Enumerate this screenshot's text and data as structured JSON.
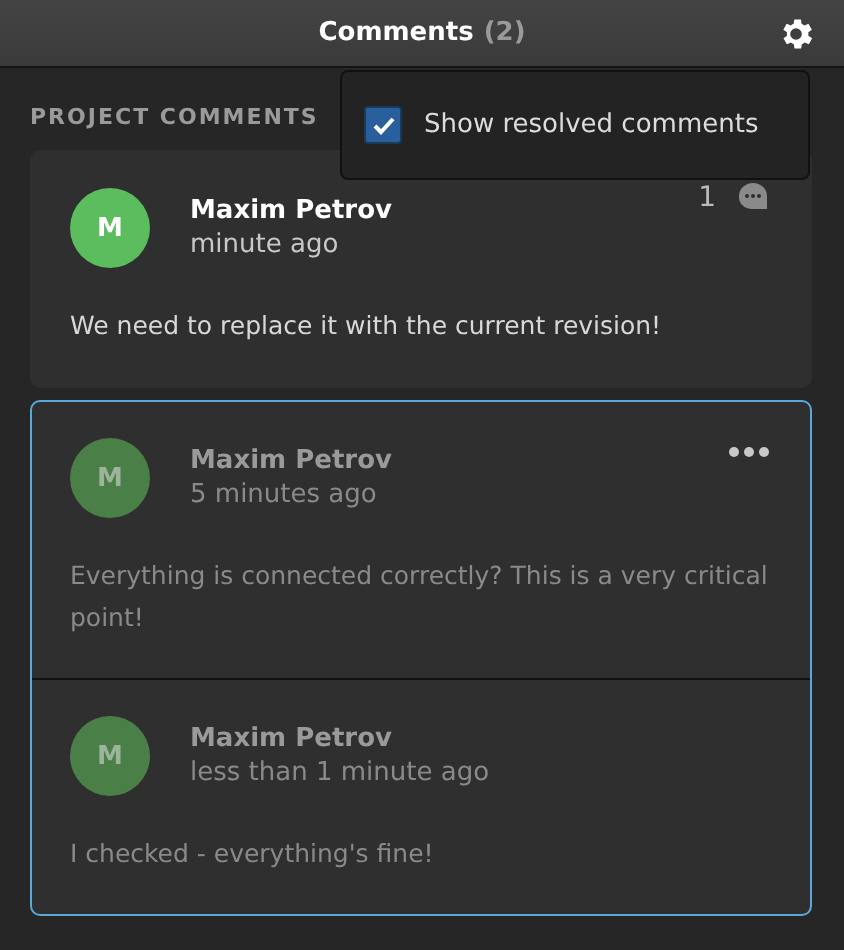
{
  "header": {
    "title": "Comments",
    "count": "(2)"
  },
  "settings_menu": {
    "open": true,
    "option": {
      "label": "Show resolved comments",
      "checked": true
    }
  },
  "section_label": "PROJECT COMMENTS",
  "threads": [
    {
      "resolved": false,
      "selected": false,
      "reply_count": "1",
      "comments": [
        {
          "initial": "M",
          "author": "Maxim Petrov",
          "time": "minute ago",
          "text": "We need to replace it with the current revision!"
        }
      ]
    },
    {
      "resolved": true,
      "selected": true,
      "comments": [
        {
          "initial": "M",
          "author": "Maxim Petrov",
          "time": "5 minutes ago",
          "text": "Everything is connected correctly? This is a very critical point!"
        },
        {
          "initial": "M",
          "author": "Maxim Petrov",
          "time": "less than 1 minute ago",
          "text": "I checked - everything's fine!"
        }
      ]
    }
  ]
}
